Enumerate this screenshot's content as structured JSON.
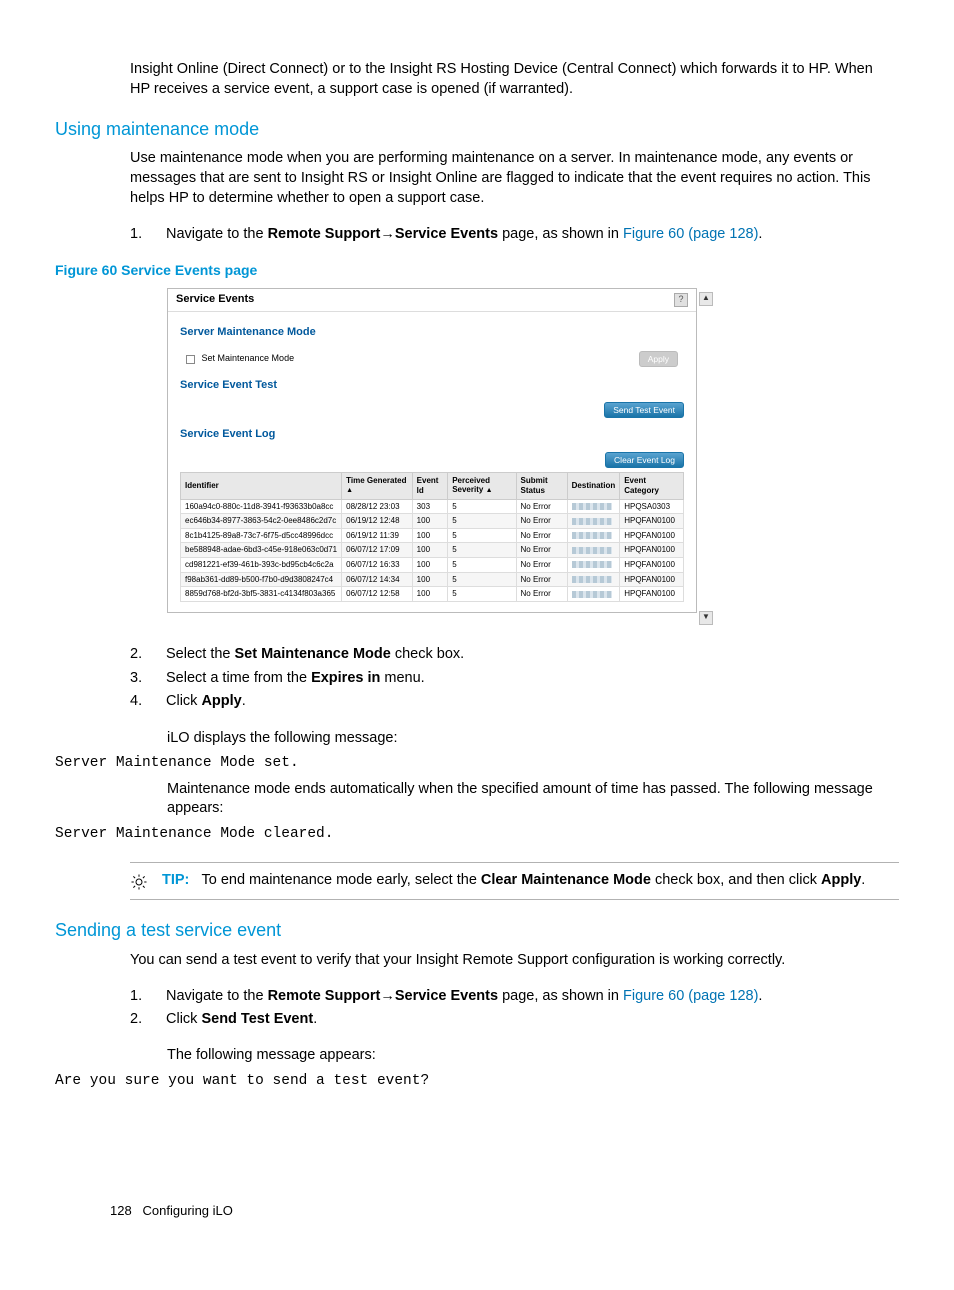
{
  "intro_para": "Insight Online (Direct Connect) or to the Insight RS Hosting Device (Central Connect) which forwards it to HP. When HP receives a service event, a support case is opened (if warranted).",
  "sections": {
    "maintenance_mode": {
      "heading": "Using maintenance mode",
      "para": "Use maintenance mode when you are performing maintenance on a server. In maintenance mode, any events or messages that are sent to Insight RS or Insight Online are flagged to indicate that the event requires no action. This helps HP to determine whether to open a support case.",
      "step1_pre": "Navigate to the ",
      "step1_b1": "Remote Support",
      "step1_arrow": "→",
      "step1_b2": "Service Events",
      "step1_post": " page, as shown in ",
      "step1_link": "Figure 60 (page 128)",
      "step1_end": ".",
      "figure_caption": "Figure 60 Service Events page",
      "step2_pre": "Select the ",
      "step2_b": "Set Maintenance Mode",
      "step2_post": " check box.",
      "step3_pre": "Select a time from the ",
      "step3_b": "Expires in",
      "step3_post": " menu.",
      "step4_pre": "Click ",
      "step4_b": "Apply",
      "step4_post": ".",
      "after4_msg": "iLO displays the following message:",
      "code1": "Server Maintenance Mode set.",
      "after4_para2": "Maintenance mode ends automatically when the specified amount of time has passed. The following message appears:",
      "code2": "Server Maintenance Mode cleared."
    },
    "tip": {
      "label": "TIP:",
      "text_pre": "To end maintenance mode early, select the ",
      "bold1": "Clear Maintenance Mode",
      "mid": " check box, and then click ",
      "bold2": "Apply",
      "end": "."
    },
    "send_test": {
      "heading": "Sending a test service event",
      "para": "You can send a test event to verify that your Insight Remote Support configuration is working correctly.",
      "step1_pre": "Navigate to the ",
      "step1_b1": "Remote Support",
      "step1_arrow": "→",
      "step1_b2": "Service Events",
      "step1_post": " page, as shown in ",
      "step1_link": "Figure 60 (page 128)",
      "step1_end": ".",
      "step2_pre": "Click ",
      "step2_b": "Send Test Event",
      "step2_post": ".",
      "after2_msg": "The following message appears:",
      "code1": "Are you sure you want to send a test event?"
    }
  },
  "screenshot": {
    "title": "Service Events",
    "help": "?",
    "section_mm": "Server Maintenance Mode",
    "mm_checkbox_label": "Set Maintenance Mode",
    "apply_btn": "Apply",
    "section_test": "Service Event Test",
    "send_test_btn": "Send Test Event",
    "section_log": "Service Event Log",
    "clear_log_btn": "Clear Event Log",
    "columns": {
      "identifier": "Identifier",
      "time": "Time Generated",
      "event_id": "Event Id",
      "severity": "Perceived Severity",
      "submit": "Submit Status",
      "destination": "Destination",
      "category": "Event Category"
    },
    "rows": [
      {
        "id": "160a94c0-880c-11d8-3941-f93633b0a8cc",
        "time": "08/28/12 23:03",
        "eid": "303",
        "sev": "5",
        "status": "No Error",
        "cat": "HPQSA0303"
      },
      {
        "id": "ec646b34-8977-3863-54c2-0ee8486c2d7c",
        "time": "06/19/12 12:48",
        "eid": "100",
        "sev": "5",
        "status": "No Error",
        "cat": "HPQFAN0100"
      },
      {
        "id": "8c1b4125-89a8-73c7-6f75-d5cc48996dcc",
        "time": "06/19/12 11:39",
        "eid": "100",
        "sev": "5",
        "status": "No Error",
        "cat": "HPQFAN0100"
      },
      {
        "id": "be588948-adae-6bd3-c45e-918e063c0d71",
        "time": "06/07/12 17:09",
        "eid": "100",
        "sev": "5",
        "status": "No Error",
        "cat": "HPQFAN0100"
      },
      {
        "id": "cd981221-ef39-461b-393c-bd95cb4c6c2a",
        "time": "06/07/12 16:33",
        "eid": "100",
        "sev": "5",
        "status": "No Error",
        "cat": "HPQFAN0100"
      },
      {
        "id": "f98ab361-dd89-b500-f7b0-d9d3808247c4",
        "time": "06/07/12 14:34",
        "eid": "100",
        "sev": "5",
        "status": "No Error",
        "cat": "HPQFAN0100"
      },
      {
        "id": "8859d768-bf2d-3bf5-3831-c4134f803a365",
        "time": "06/07/12 12:58",
        "eid": "100",
        "sev": "5",
        "status": "No Error",
        "cat": "HPQFAN0100"
      }
    ]
  },
  "footer": {
    "page": "128",
    "label": "Configuring iLO"
  },
  "nums": {
    "n1": "1.",
    "n2": "2.",
    "n3": "3.",
    "n4": "4."
  },
  "sort_arrow": "▲"
}
